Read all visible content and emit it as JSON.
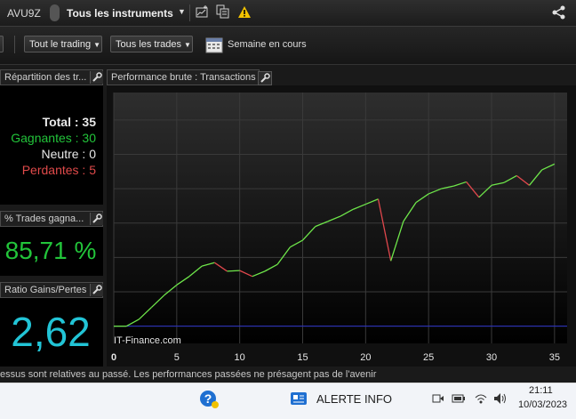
{
  "topbar": {
    "account": "AVU9Z",
    "instruments": "Tous les instruments"
  },
  "toolbar": {
    "trading": "Tout le trading",
    "trades": "Tous les trades",
    "period": "Semaine en cours"
  },
  "panels": {
    "repartition_title": "Répartition des tr...",
    "total": "Total : 35",
    "gagnantes": "Gagnantes : 30",
    "neutre": "Neutre : 0",
    "perdantes": "Perdantes : 5",
    "pct_title": "% Trades gagna...",
    "pct_value": "85,71 %",
    "ratio_title": "Ratio Gains/Pertes",
    "ratio_value": "2,62"
  },
  "chart": {
    "title": "Performance brute : Transactions",
    "watermark": "IT-Finance.com"
  },
  "chart_data": {
    "type": "line",
    "title": "Performance brute : Transactions",
    "xlabel": "",
    "ylabel": "",
    "x_ticks": [
      "0",
      "5",
      "10",
      "15",
      "20",
      "25",
      "30",
      "35"
    ],
    "xlim": [
      0,
      36
    ],
    "ylim": [
      -0.5,
      6.8
    ],
    "grid": true,
    "baseline": 0,
    "x": [
      0,
      1,
      2,
      3,
      4,
      5,
      6,
      7,
      8,
      9,
      10,
      11,
      12,
      13,
      14,
      15,
      16,
      17,
      18,
      19,
      20,
      21,
      22,
      23,
      24,
      25,
      26,
      27,
      28,
      29,
      30,
      31,
      32,
      33,
      34,
      35
    ],
    "y": [
      0,
      0,
      0.2,
      0.55,
      0.9,
      1.2,
      1.45,
      1.75,
      1.85,
      1.6,
      1.62,
      1.45,
      1.6,
      1.8,
      2.3,
      2.5,
      2.9,
      3.05,
      3.2,
      3.4,
      3.55,
      3.7,
      1.9,
      3.05,
      3.6,
      3.85,
      4.0,
      4.08,
      4.2,
      3.75,
      4.1,
      4.18,
      4.38,
      4.1,
      4.55,
      4.72
    ],
    "win_color": "#6ee64a",
    "loss_color": "#e0474c"
  },
  "colors": {
    "win": "#22c43a",
    "loss": "#e04a4a",
    "neutral": "#e8e8e8",
    "ratio": "#22c4d6",
    "baseline": "#2b32c8"
  },
  "footer": {
    "disclaimer": "essus sont relatives au passé. Les performances passées ne présagent pas de l'avenir"
  },
  "taskbar": {
    "alert": "ALERTE INFO",
    "time": "21:11",
    "date": "10/03/2023",
    "icons": [
      "help-icon",
      "news-icon",
      "meet-icon",
      "battery-icon",
      "wifi-icon",
      "volume-icon"
    ]
  }
}
